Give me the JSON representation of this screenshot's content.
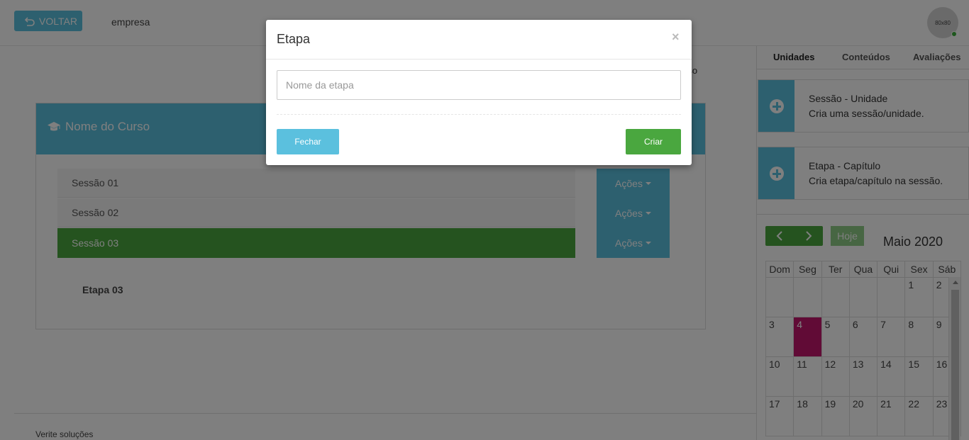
{
  "header": {
    "back_label": "VOLTAR",
    "company": "empresa",
    "avatar_text": "80x80"
  },
  "background_text": "rso",
  "course": {
    "title": "Nome do Curso",
    "sessions": [
      {
        "label": "Sessão 01",
        "actions_label": "Ações"
      },
      {
        "label": "Sessão 02",
        "actions_label": "Ações"
      },
      {
        "label": "Sessão 03",
        "actions_label": "Ações",
        "active": true
      }
    ],
    "stage_label": "Etapa 03"
  },
  "footer": {
    "text": "Verite soluções"
  },
  "right_panel": {
    "tabs": [
      {
        "label": "Unidades",
        "active": true
      },
      {
        "label": "Conteúdos"
      },
      {
        "label": "Avaliações"
      }
    ],
    "cards": [
      {
        "title": "Sessão - Unidade",
        "description": "Cria uma sessão/unidade.",
        "icon": "plus-circle-icon"
      },
      {
        "title": "Etapa - Capítulo",
        "description": "Cria etapa/capítulo na sessão.",
        "icon": "plus-circle-icon"
      }
    ],
    "calendar": {
      "today_label": "Hoje",
      "title": "Maio 2020",
      "weekdays": [
        "Dom",
        "Seg",
        "Ter",
        "Qua",
        "Qui",
        "Sex",
        "Sáb"
      ],
      "weeks": [
        [
          "",
          "",
          "",
          "",
          "",
          "1",
          "2"
        ],
        [
          "3",
          "4",
          "5",
          "6",
          "7",
          "8",
          "9"
        ],
        [
          "10",
          "11",
          "12",
          "13",
          "14",
          "15",
          "16"
        ],
        [
          "17",
          "18",
          "19",
          "20",
          "21",
          "22",
          "23"
        ]
      ],
      "highlighted_day": "4",
      "highlight_color": "#c2166d"
    }
  },
  "modal": {
    "title": "Etapa",
    "close_symbol": "×",
    "input_placeholder": "Nome da etapa",
    "input_value": "",
    "close_button": "Fechar",
    "create_button": "Criar"
  },
  "colors": {
    "info": "#5bc0de",
    "success": "#4aa73f",
    "today": "#c2166d"
  }
}
